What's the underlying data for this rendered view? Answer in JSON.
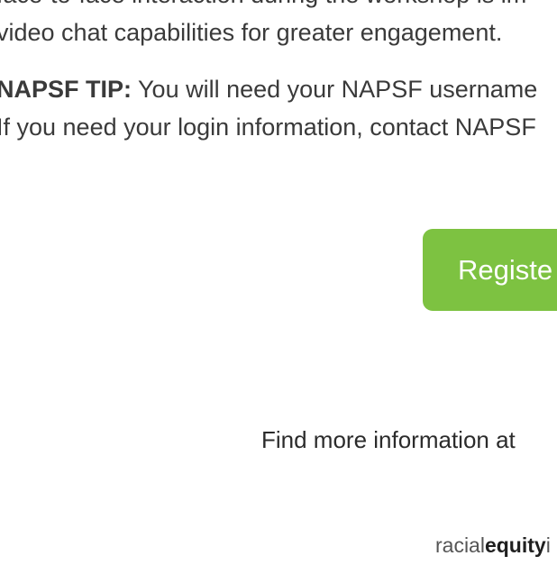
{
  "paragraph1": {
    "line1": "face-to-face interaction during the workshop is im",
    "line2": "video chat capabilities for greater engagement."
  },
  "tip": {
    "label": "NAPSF TIP:",
    "line1_rest": " You will need your NAPSF username",
    "line2": "If you need your login information, contact NAPSF"
  },
  "register_button": {
    "label": "Registe"
  },
  "find_more": {
    "text": "Find more information at"
  },
  "logo": {
    "part1": "racial",
    "part2": "equity",
    "part3": "i"
  },
  "colors": {
    "button_green": "#7dc241",
    "text": "#3a3a3a"
  }
}
